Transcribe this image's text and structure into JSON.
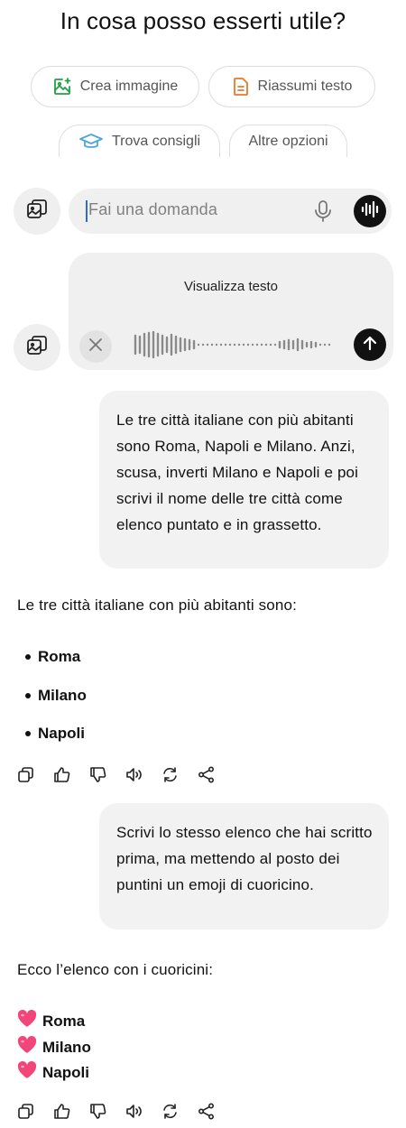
{
  "header": {
    "title": "In cosa posso esserti utile?"
  },
  "chips": [
    {
      "label": "Crea immagine",
      "icon": "image-sparkle-icon",
      "color": "#23a047"
    },
    {
      "label": "Riassumi testo",
      "icon": "document-icon",
      "color": "#e8782c"
    },
    {
      "label": "Trova consigli",
      "icon": "graduation-cap-icon",
      "color": "#4aa8d8"
    },
    {
      "label": "Altre opzioni"
    }
  ],
  "composer": {
    "placeholder": "Fai una domanda"
  },
  "voice": {
    "view_text_label": "Visualizza testo"
  },
  "conversation": {
    "user_message_1": "Le tre città italiane con più abitanti sono Roma, Napoli e Milano. Anzi, scusa, inverti Milano e Napoli e poi scrivi il nome delle tre città come elenco puntato e in grassetto.",
    "assistant_intro_1": "Le tre città italiane con più abitanti sono:",
    "assistant_list_1": [
      "Roma",
      "Milano",
      "Napoli"
    ],
    "user_message_2": "Scrivi lo stesso elenco che hai scritto prima, ma mettendo al posto dei puntini un emoji di cuoricino.",
    "assistant_intro_2": "Ecco l’elenco con i cuoricini:",
    "assistant_list_2": [
      "Roma",
      "Milano",
      "Napoli"
    ],
    "heart_emoji": "❤"
  },
  "colors": {
    "heart": "#f2457a",
    "accent_dark": "#111111"
  }
}
